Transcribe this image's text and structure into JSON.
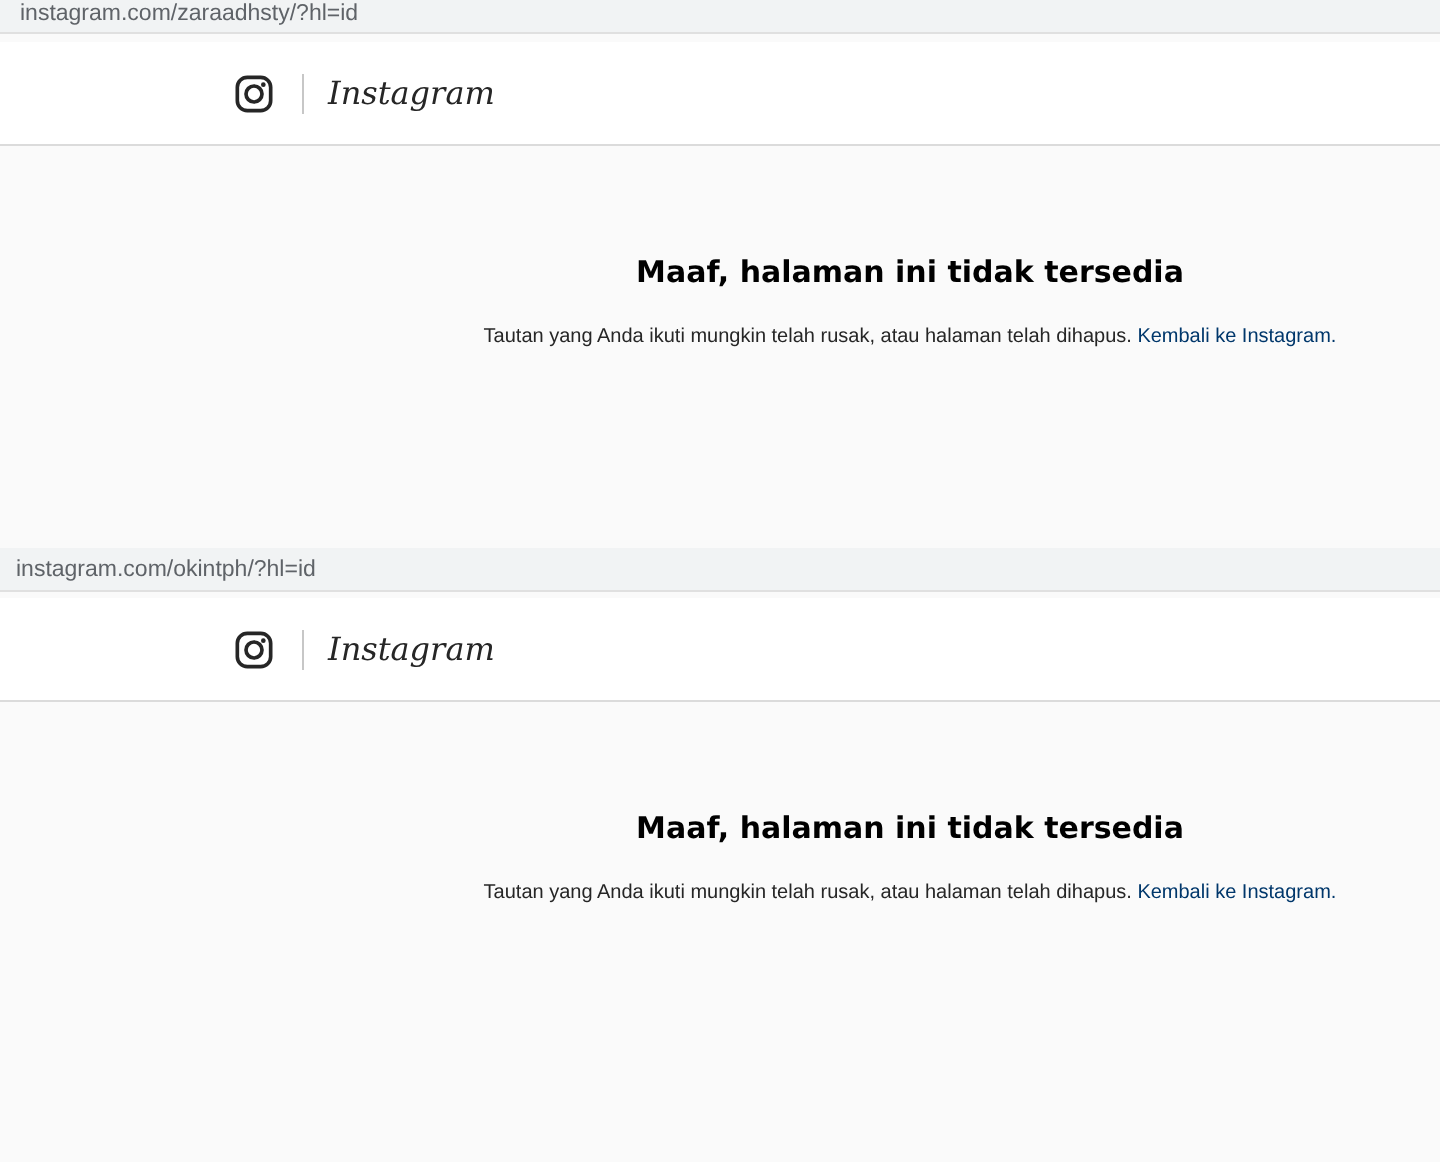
{
  "captures": [
    {
      "address_bar": {
        "url": "instagram.com/zaraadhsty/?hl=id"
      },
      "header": {
        "logo_text": "Instagram"
      },
      "message": {
        "title": "Maaf, halaman ini tidak tersedia",
        "body": "Tautan yang Anda ikuti mungkin telah rusak, atau halaman telah dihapus.",
        "link": "Kembali ke Instagram."
      }
    },
    {
      "address_bar": {
        "url": "instagram.com/okintph/?hl=id"
      },
      "header": {
        "logo_text": "Instagram"
      },
      "message": {
        "title": "Maaf, halaman ini tidak tersedia",
        "body": "Tautan yang Anda ikuti mungkin telah rusak, atau halaman telah dihapus.",
        "link": "Kembali ke Instagram."
      }
    }
  ]
}
